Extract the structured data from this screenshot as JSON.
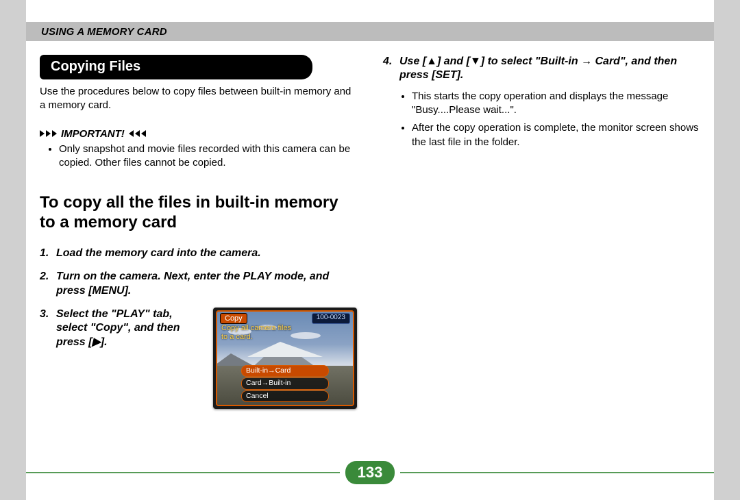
{
  "header": {
    "section": "USING A MEMORY CARD"
  },
  "left": {
    "pill_title": "Copying Files",
    "intro": "Use the procedures below to copy files between built-in memory and a memory card.",
    "important_label": "IMPORTANT!",
    "important_bullets": [
      "Only snapshot and movie files recorded with this camera can be copied. Other files cannot be copied."
    ],
    "subheading": "To copy all the files in built-in memory to a memory card",
    "steps": {
      "s1": "Load the memory card into the camera.",
      "s2": "Turn on the camera. Next, enter the PLAY mode, and press [MENU].",
      "s3": "Select the \"PLAY\" tab, select \"Copy\", and then press [▶]."
    },
    "camera_screenshot": {
      "title_tag": "Copy",
      "file_id": "100-0023",
      "caption_line1": "Copy all camera files",
      "caption_line2": "to a card.",
      "menu": {
        "opt1": "Built-in→Card",
        "opt2": "Card→Built-in",
        "opt3": "Cancel"
      }
    }
  },
  "right": {
    "step4_num": "4.",
    "step4_text": "Use [▲] and [▼] to select \"Built-in → Card\", and then press [SET].",
    "step4_bullets": [
      "This starts the copy operation and displays the message \"Busy....Please wait...\".",
      "After the copy operation is complete, the monitor screen shows the last file in the folder."
    ]
  },
  "page_number": "133"
}
